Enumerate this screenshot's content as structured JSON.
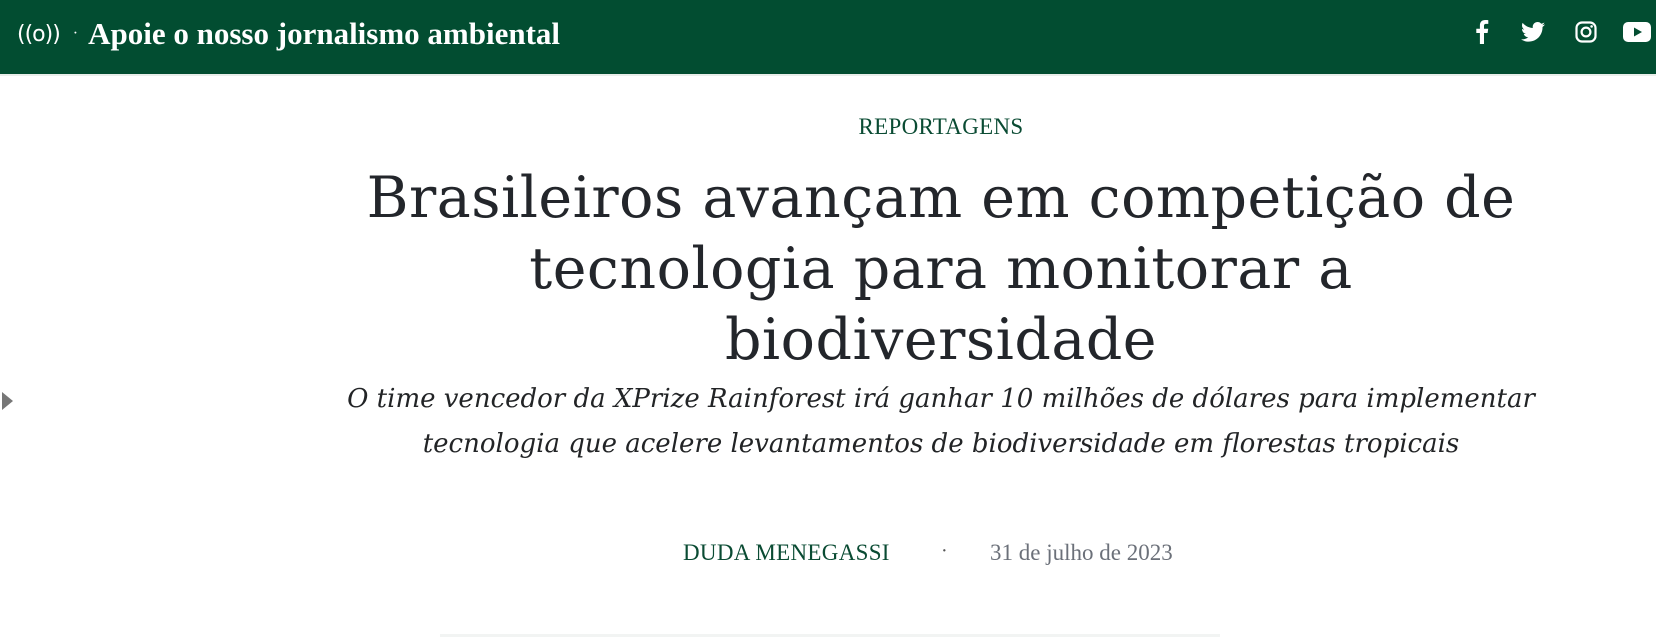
{
  "header": {
    "logo_glyph": "((o))",
    "separator": "·",
    "tagline": "Apoie o nosso jornalismo ambiental",
    "background_color": "#024d31",
    "social": [
      {
        "icon": "facebook-icon"
      },
      {
        "icon": "twitter-icon"
      },
      {
        "icon": "instagram-icon"
      },
      {
        "icon": "youtube-icon"
      }
    ]
  },
  "article": {
    "section": "REPORTAGENS",
    "headline_line1": "Brasileiros avançam em competição de",
    "headline_line2": "tecnologia para monitorar a biodiversidade",
    "subtitle_line1": "O time vencedor da XPrize Rainforest irá ganhar 10 milhões de dólares para implementar",
    "subtitle_line2": "tecnologia que acelere levantamentos de biodiversidade em florestas tropicais",
    "author": "DUDA MENEGASSI",
    "byline_separator": "·",
    "date": "31 de julho de 2023",
    "accent_color": "#0a4b33"
  }
}
